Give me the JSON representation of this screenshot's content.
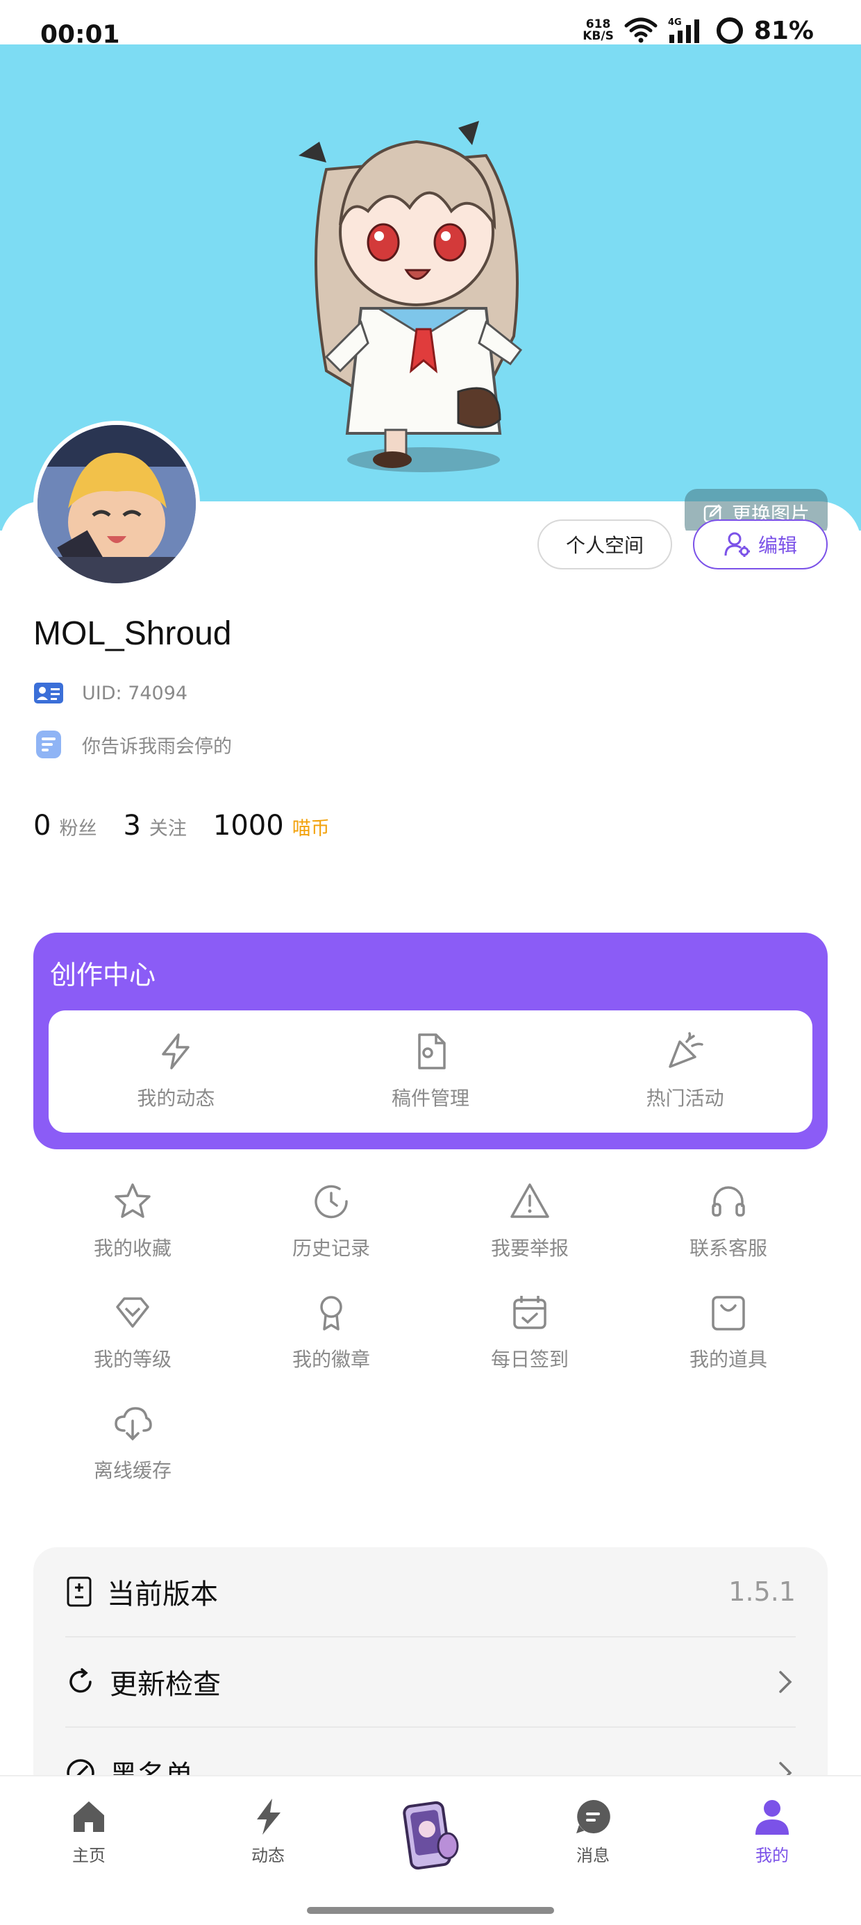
{
  "status_bar": {
    "time": "00:01",
    "net_speed_value": "618",
    "net_speed_unit": "KB/S",
    "battery": "81%",
    "icons": [
      "wifi-icon",
      "cellular-4g-icon",
      "signal-bars-icon",
      "battery-ring-icon"
    ]
  },
  "banner": {
    "change_image_label": "更换图片"
  },
  "profile": {
    "space_button": "个人空间",
    "edit_button": "编辑",
    "username": "MOL_Shroud",
    "uid": "UID: 74094",
    "bio": "你告诉我雨会停的",
    "stats": {
      "fans_count": "0",
      "fans_label": "粉丝",
      "follow_count": "3",
      "follow_label": "关注",
      "coins_count": "1000",
      "coins_label": "喵币"
    }
  },
  "creator_center": {
    "title": "创作中心",
    "items": [
      {
        "label": "我的动态",
        "icon": "lightning-icon"
      },
      {
        "label": "稿件管理",
        "icon": "document-gear-icon"
      },
      {
        "label": "热门活动",
        "icon": "party-popper-icon"
      }
    ]
  },
  "grid": {
    "items": [
      {
        "label": "我的收藏",
        "icon": "star-icon"
      },
      {
        "label": "历史记录",
        "icon": "history-clock-icon"
      },
      {
        "label": "我要举报",
        "icon": "warning-icon"
      },
      {
        "label": "联系客服",
        "icon": "headphones-icon"
      },
      {
        "label": "我的等级",
        "icon": "diamond-icon"
      },
      {
        "label": "我的徽章",
        "icon": "badge-medal-icon"
      },
      {
        "label": "每日签到",
        "icon": "calendar-check-icon"
      },
      {
        "label": "我的道具",
        "icon": "shopping-bag-icon"
      },
      {
        "label": "离线缓存",
        "icon": "cloud-download-icon"
      }
    ]
  },
  "settings": {
    "version_label": "当前版本",
    "version_value": "1.5.1",
    "update_label": "更新检查",
    "blacklist_label": "黑名单"
  },
  "bottom_nav": {
    "items": [
      {
        "label": "主页",
        "icon": "home-icon"
      },
      {
        "label": "动态",
        "icon": "lightning-icon"
      },
      {
        "label": "",
        "icon": "center-character-icon"
      },
      {
        "label": "消息",
        "icon": "message-bubble-icon"
      },
      {
        "label": "我的",
        "icon": "user-icon"
      }
    ],
    "active_color": "#7b52e8"
  },
  "colors": {
    "accent": "#8b5cf6",
    "banner_bg": "#7ddcf3",
    "coin": "#f2a20c"
  }
}
